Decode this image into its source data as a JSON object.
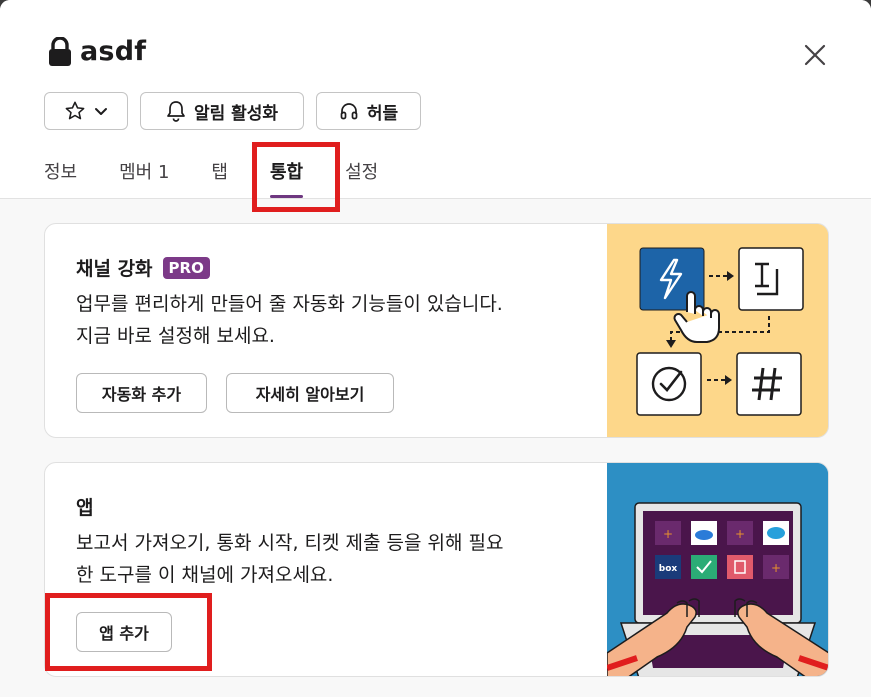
{
  "channel": {
    "title": "asdf"
  },
  "header_buttons": {
    "notifications_label": "알림 활성화",
    "huddle_label": "허들"
  },
  "tabs": [
    {
      "label": "정보"
    },
    {
      "label": "멤버 1"
    },
    {
      "label": "탭"
    },
    {
      "label": "통합",
      "active": true
    },
    {
      "label": "설정"
    }
  ],
  "automation_card": {
    "title": "채널 강화",
    "badge": "PRO",
    "description_line1": "업무를 편리하게 만들어 줄 자동화 기능들이 있습니다.",
    "description_line2": "지금 바로 설정해 보세요.",
    "add_automation_label": "자동화 추가",
    "learn_more_label": "자세히 알아보기"
  },
  "apps_card": {
    "title": "앱",
    "description_line1": "보고서 가져오기, 통화 시작, 티켓 제출 등을 위해 필요",
    "description_line2": "한 도구를 이 채널에 가져오세요.",
    "add_app_label": "앱 추가",
    "illustration_box_text": "box"
  },
  "colors": {
    "accent_purple": "#6e3780",
    "pro_badge": "#7c3a88",
    "highlight_red": "#e01e1e",
    "automation_illustration_bg": "#fdd78a",
    "apps_illustration_bg": "#2d8fc4"
  },
  "icons": [
    "lock-icon",
    "close-icon",
    "star-icon",
    "chevron-down-icon",
    "bell-icon",
    "headphones-icon",
    "lightning-icon",
    "text-box-icon",
    "check-circle-icon",
    "hashtag-icon",
    "pointer-hand-icon",
    "laptop-icon"
  ]
}
